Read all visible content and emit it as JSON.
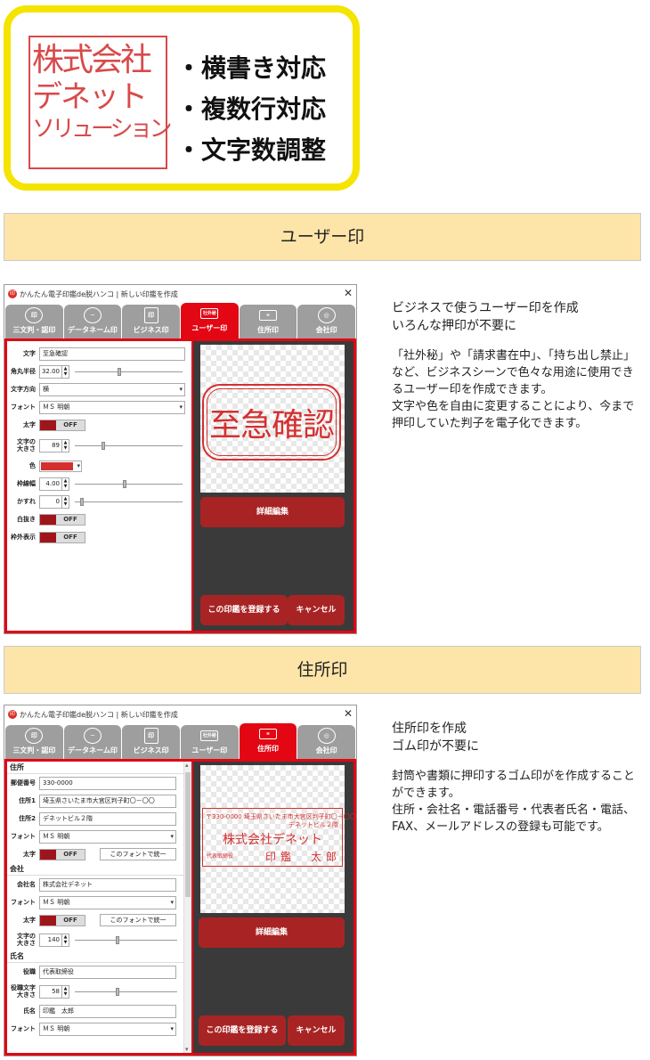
{
  "hero": {
    "stamp_lines": [
      "株式会社",
      "デネット",
      "ソリューション"
    ],
    "features": [
      "・横書き対応",
      "・複数行対応",
      "・文字数調整"
    ]
  },
  "sections": {
    "user": {
      "title": "ユーザー印"
    },
    "address": {
      "title": "住所印"
    }
  },
  "window_title": "かんたん電子印鑑de脱ハンコ | 新しい印鑑を作成",
  "tabs": [
    {
      "label": "三文判・認印",
      "icon": "round-seal-icon"
    },
    {
      "label": "データネーム印",
      "icon": "date-seal-icon"
    },
    {
      "label": "ビジネス印",
      "icon": "square-seal-icon"
    },
    {
      "label": "ユーザー印",
      "icon": "user-seal-icon"
    },
    {
      "label": "住所印",
      "icon": "address-seal-icon"
    },
    {
      "label": "会社印",
      "icon": "company-seal-icon"
    }
  ],
  "user_form": {
    "text_label": "文字",
    "text_value": "至急確認",
    "corner_label": "角丸半径",
    "corner_value": "32.00",
    "direction_label": "文字方向",
    "direction_value": "横",
    "font_label": "フォント",
    "font_value": "ＭＳ 明朝",
    "bold_label": "太字",
    "bold_state": "OFF",
    "size_label_1": "文字の",
    "size_label_2": "大きさ",
    "size_value": "89",
    "color_label": "色",
    "color_value": "#d43030",
    "border_label": "枠線幅",
    "border_value": "4.00",
    "blur_label": "かすれ",
    "blur_value": "0",
    "outline_label": "白抜き",
    "outline_state": "OFF",
    "frame_label": "枠外表示",
    "frame_state": "OFF"
  },
  "user_preview": {
    "stamp_text": "至急確認"
  },
  "buttons": {
    "detail_edit": "詳細編集",
    "register": "この印鑑を登録する",
    "cancel": "キャンセル"
  },
  "address_form": {
    "group_address": "住所",
    "zip_label": "郵便番号",
    "zip_value": "330-0000",
    "addr1_label": "住所1",
    "addr1_value": "埼玉県さいたま市大宮区判子町〇－〇〇",
    "addr2_label": "住所2",
    "addr2_value": "デネットビル２階",
    "font_label": "フォント",
    "font_value": "ＭＳ 明朝",
    "bold_label": "太字",
    "bold_state": "OFF",
    "unify_label": "このフォントで統一",
    "group_company": "会社",
    "company_label": "会社名",
    "company_value": "株式会社デネット",
    "c_font_label": "フォント",
    "c_font_value": "ＭＳ 明朝",
    "c_bold_label": "太字",
    "c_bold_state": "OFF",
    "c_unify_label": "このフォントで統一",
    "c_size_label_1": "文字の",
    "c_size_label_2": "大きさ",
    "c_size_value": "140",
    "group_name": "氏名",
    "title_label": "役職",
    "title_value": "代表取締役",
    "t_size_label_1": "役職文字",
    "t_size_label_2": "大きさ",
    "t_size_value": "58",
    "name_label": "氏名",
    "name_value": "印鑑　太郎",
    "n_font_label": "フォント",
    "n_font_value": "ＭＳ 明朝"
  },
  "address_preview": {
    "line1": "〒330-0000 埼玉県さいたま市大宮区判子町〇－〇〇",
    "line2": "デネットビル２階",
    "company": "株式会社デネット",
    "title": "代表取締役",
    "name": "印鑑　太郎"
  },
  "user_desc": {
    "lead_1": "ビジネスで使うユーザー印を作成",
    "lead_2": "いろんな押印が不要に",
    "body_1": "「社外秘」や「請求書在中」、「持ち出し禁止」など、ビジネスシーンで色々な用途に使用できるユーザー印を作成できます。",
    "body_2": "文字や色を自由に変更することにより、今まで押印していた判子を電子化できます。"
  },
  "address_desc": {
    "lead_1": "住所印を作成",
    "lead_2": "ゴム印が不要に",
    "body_1": "封筒や書類に押印するゴム印がを作成することができます。",
    "body_2": "住所・会社名・電話番号・代表者氏名・電話、FAX、メールアドレスの登録も可能です。"
  }
}
